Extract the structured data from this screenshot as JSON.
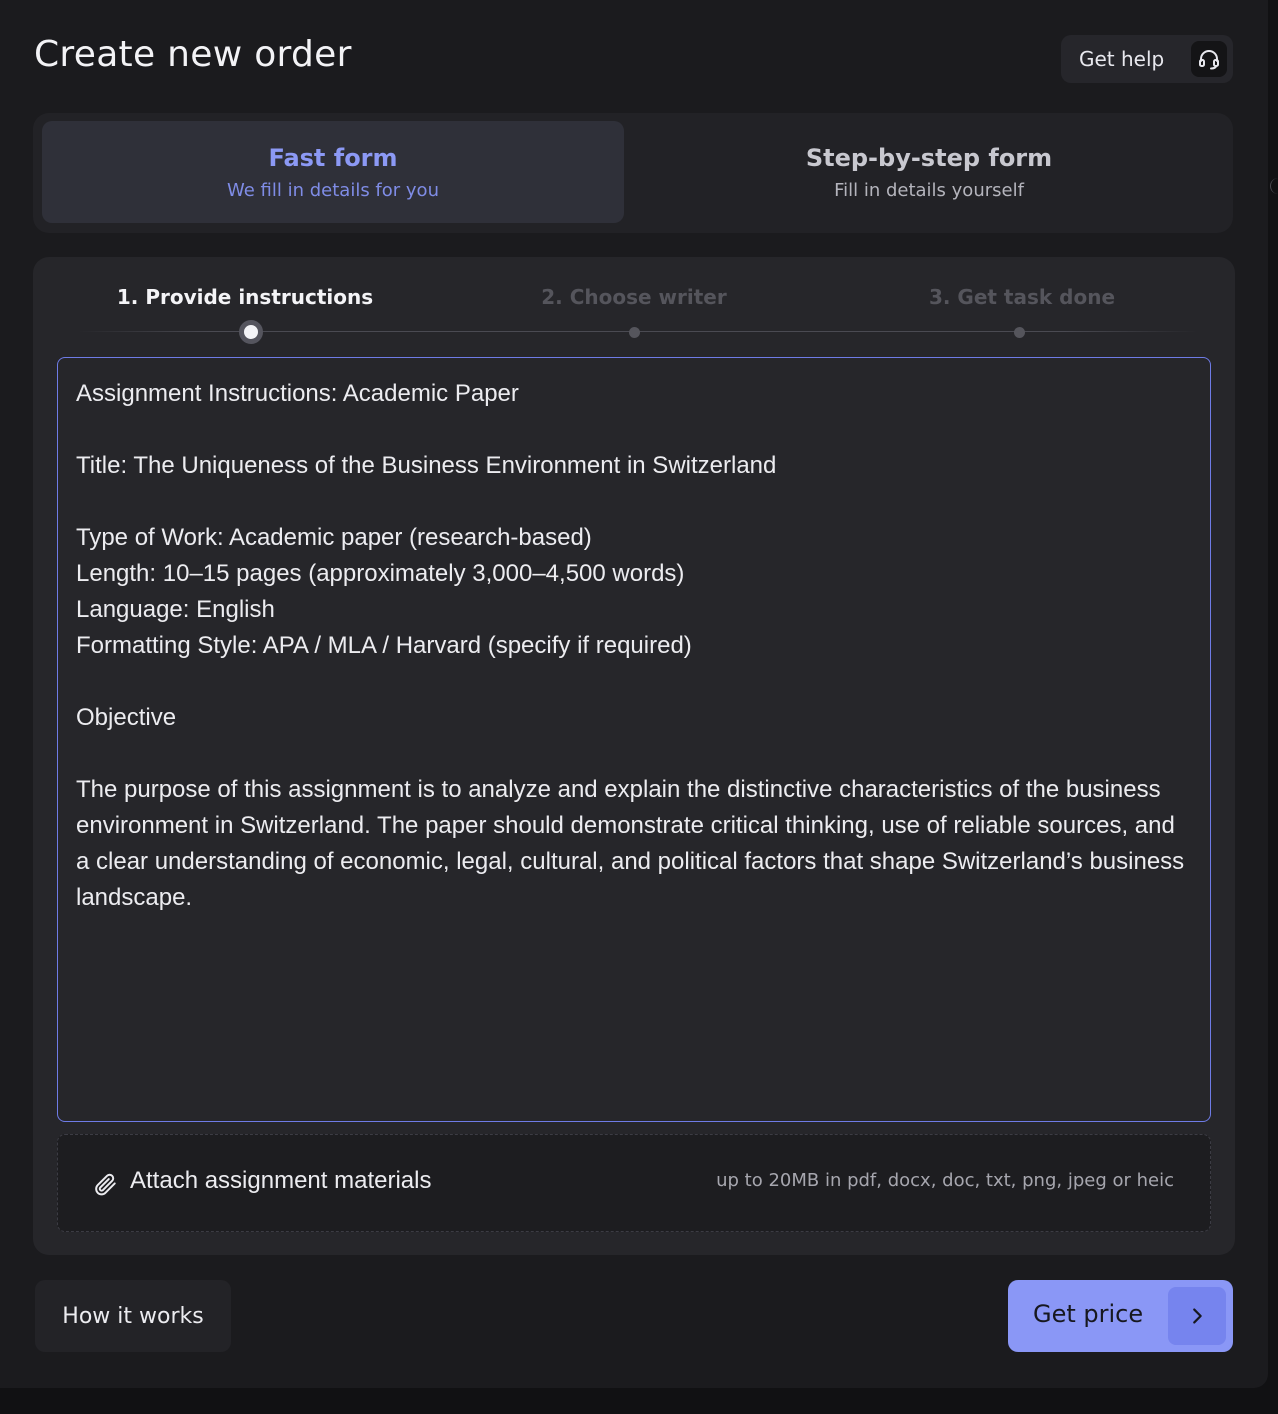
{
  "header": {
    "title": "Create new order",
    "help_label": "Get help",
    "help_icon": "headset-icon"
  },
  "mode_switch": {
    "fast": {
      "title": "Fast form",
      "subtitle": "We fill in details for you",
      "active": true
    },
    "step": {
      "title": "Step-by-step form",
      "subtitle": "Fill in details yourself",
      "active": false
    }
  },
  "steps": [
    {
      "label": "1. Provide instructions",
      "active": true
    },
    {
      "label": "2. Choose writer",
      "active": false
    },
    {
      "label": "3. Get task done",
      "active": false
    }
  ],
  "instructions": {
    "value": "Assignment Instructions: Academic Paper\n\nTitle: The Uniqueness of the Business Environment in Switzerland\n\nType of Work: Academic paper (research-based)\nLength: 10–15 pages (approximately 3,000–4,500 words)\nLanguage: English\nFormatting Style: APA / MLA / Harvard (specify if required)\n\nObjective\n\nThe purpose of this assignment is to analyze and explain the distinctive characteristics of the business environment in Switzerland. The paper should demonstrate critical thinking, use of reliable sources, and a clear understanding of economic, legal, cultural, and political factors that shape Switzerland’s business landscape."
  },
  "attach": {
    "label": "Attach assignment materials",
    "hint": "up to 20MB in pdf, docx, doc, txt, png, jpeg or heic",
    "icon": "paperclip-icon"
  },
  "footer": {
    "how_label": "How it works",
    "price_label": "Get price",
    "price_icon": "chevron-right-icon"
  },
  "colors": {
    "accent": "#8a97f6",
    "panel": "#1b1b1e",
    "card": "#26262a"
  }
}
